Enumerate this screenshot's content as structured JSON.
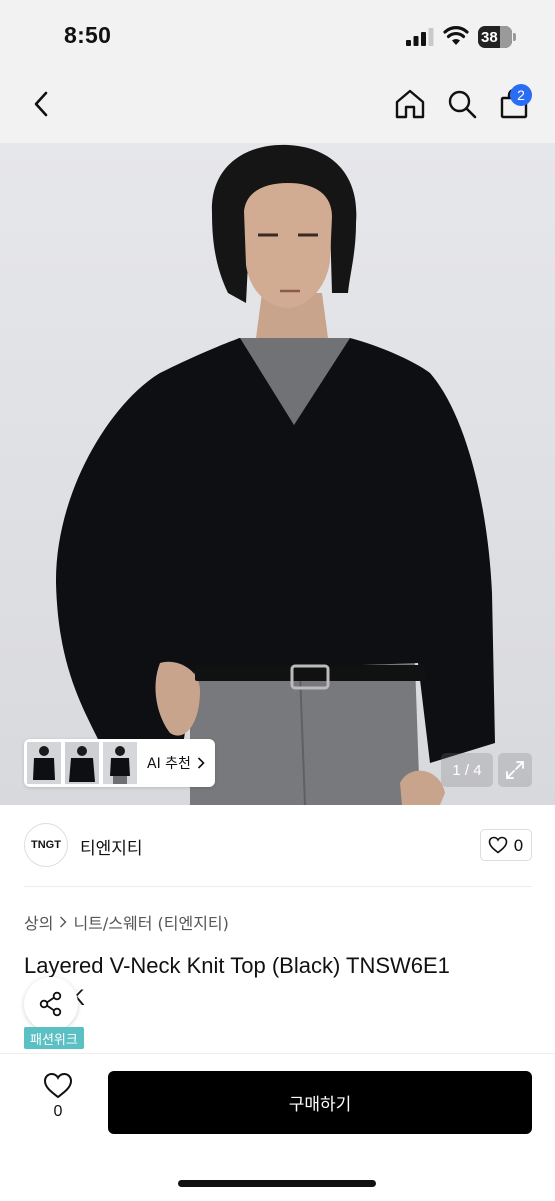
{
  "status_bar": {
    "time": "8:50",
    "battery_level": "38"
  },
  "nav": {
    "back_icon": "chevron-left-icon",
    "home_icon": "home-icon",
    "search_icon": "search-icon",
    "bag_icon": "shopping-bag-icon",
    "bag_badge": "2",
    "accent": "#2a6df4"
  },
  "gallery": {
    "ai_label": "AI 추천",
    "counter": "1 / 4",
    "expand_icon": "expand-icon",
    "thumbnails": [
      "thumbnail-1",
      "thumbnail-2",
      "thumbnail-3"
    ]
  },
  "brand": {
    "logo_text": "TNGT",
    "name": "티엔지티",
    "like_count": "0"
  },
  "breadcrumb": {
    "category": "상의",
    "subcategory": "니트/스웨터 (티엔지티)"
  },
  "product": {
    "title": "Layered V-Neck Knit Top (Black) TNSW6E1",
    "title_line2": "K",
    "tag": "패션위크",
    "tag_color": "#5bc0c4"
  },
  "bottom_bar": {
    "wish_count": "0",
    "buy_label": "구매하기"
  }
}
